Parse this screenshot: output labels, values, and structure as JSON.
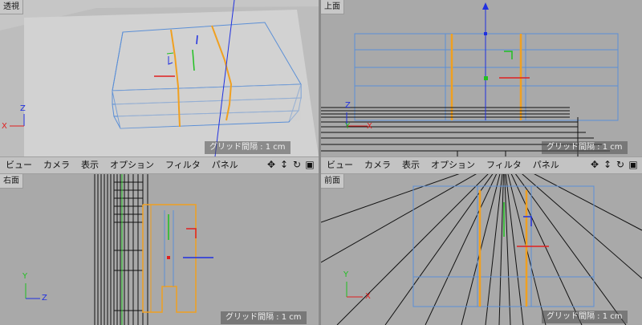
{
  "viewports": {
    "perspective": {
      "label": "透視",
      "grid": "グリッド間隔 : 1 cm"
    },
    "top": {
      "label": "上面",
      "grid": "グリッド間隔 : 1 cm"
    },
    "right": {
      "label": "右面",
      "grid": "グリッド間隔 : 1 cm"
    },
    "front": {
      "label": "前面",
      "grid": "グリッド間隔 : 1 cm"
    }
  },
  "menu": {
    "view": "ビュー",
    "camera": "カメラ",
    "display": "表示",
    "options": "オプション",
    "filter": "フィルタ",
    "panel": "パネル"
  },
  "nav_icons": [
    "move-view-icon",
    "zoom-view-icon",
    "rotate-view-icon",
    "toggle-layout-icon"
  ],
  "axes": {
    "x": "X",
    "y": "Y",
    "z": "Z"
  },
  "colors": {
    "wire": "#5b8fd6",
    "edge_selected": "#f0a020",
    "axis_x": "#e02020",
    "axis_y": "#20c020",
    "axis_z": "#2030e0"
  }
}
